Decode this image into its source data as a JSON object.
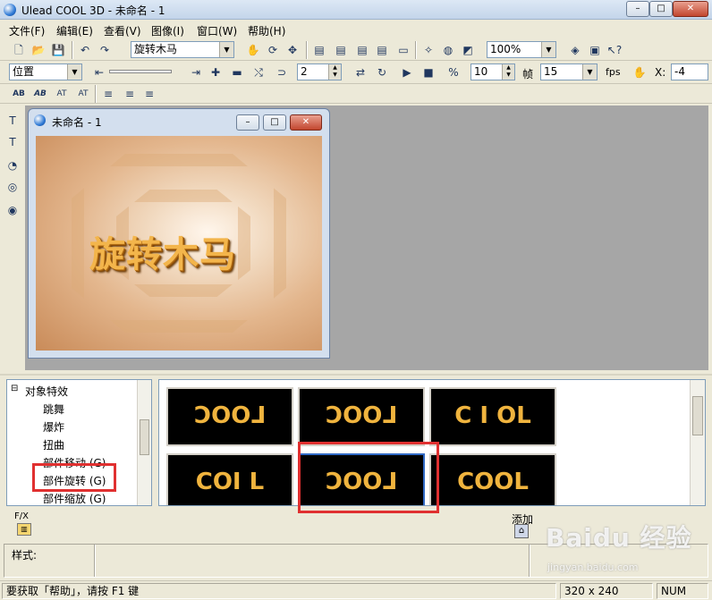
{
  "window": {
    "title": "Ulead COOL 3D - 未命名 - 1",
    "buttons": {
      "minimize": "–",
      "maximize": "□",
      "close": "✕"
    }
  },
  "menu": [
    "文件(F)",
    "编辑(E)",
    "查看(V)",
    "图像(I)",
    "窗口(W)",
    "帮助(H)"
  ],
  "toolbar1": {
    "text_combo": "旋转木马",
    "zoom_combo": "100%"
  },
  "toolbar2": {
    "mode_combo": "位置",
    "value1": "2",
    "value2": "10",
    "frame_label": "帧",
    "value3": "15",
    "fps_label": "fps",
    "x_label": "X:",
    "x_value": "-4"
  },
  "toolbar3": {
    "text_effects": [
      "AB",
      "AB",
      "AT",
      "AT"
    ]
  },
  "docwin": {
    "title": "未命名 - 1",
    "canvas_text": "旋转木马"
  },
  "tree": {
    "root": "对象特效",
    "items": [
      "跳舞",
      "爆炸",
      "扭曲",
      "部件移动 (G)",
      "部件旋转 (G)",
      "部件缩放 (G)"
    ]
  },
  "thumbnails": [
    {
      "label": "ƆOO⅃"
    },
    {
      "label": "ƆOO⅃"
    },
    {
      "label": "C I OL"
    },
    {
      "label": "COI L"
    },
    {
      "label": "ƆOO⅃"
    },
    {
      "label": "COOL"
    }
  ],
  "fx_label": "F/X",
  "add_label": "添加",
  "style_label": "样式:",
  "status": {
    "help": "要获取「帮助」，请按 F1 键",
    "size": "320 x 240",
    "num": "NUM"
  },
  "watermark": {
    "brand": "Baidu 经验",
    "url": "jingyan.baidu.com"
  },
  "colors": {
    "highlight": "#e03030",
    "canvas_text": "#f3b54b",
    "workspace": "#a6a6a6"
  }
}
